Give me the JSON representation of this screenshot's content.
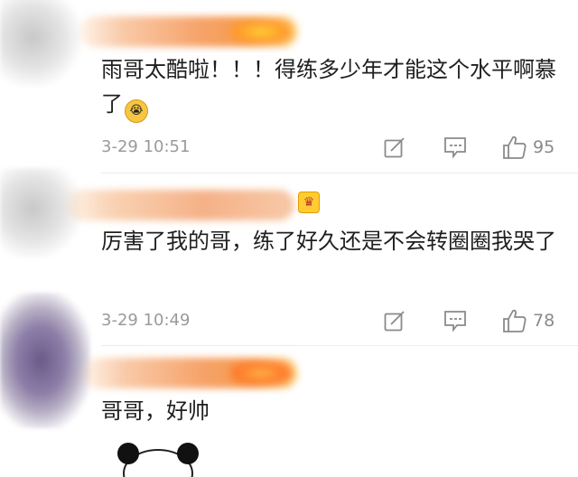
{
  "comments": [
    {
      "text": "雨哥太酷啦！！！得练多少年才能这个水平啊慕了",
      "emoji": "😭",
      "time": "3-29 10:51",
      "likes": "95"
    },
    {
      "text": "厉害了我的哥，练了好久还是不会转圈圈我哭了",
      "time": "3-29 10:49",
      "likes": "78"
    },
    {
      "text": "哥哥，好帅"
    }
  ],
  "icons": {
    "share": "share-icon",
    "reply": "comment-icon",
    "like": "thumbs-up-icon"
  },
  "colors": {
    "text": "#1f1f1f",
    "meta": "#9a9a9a",
    "divider": "#ececec"
  }
}
